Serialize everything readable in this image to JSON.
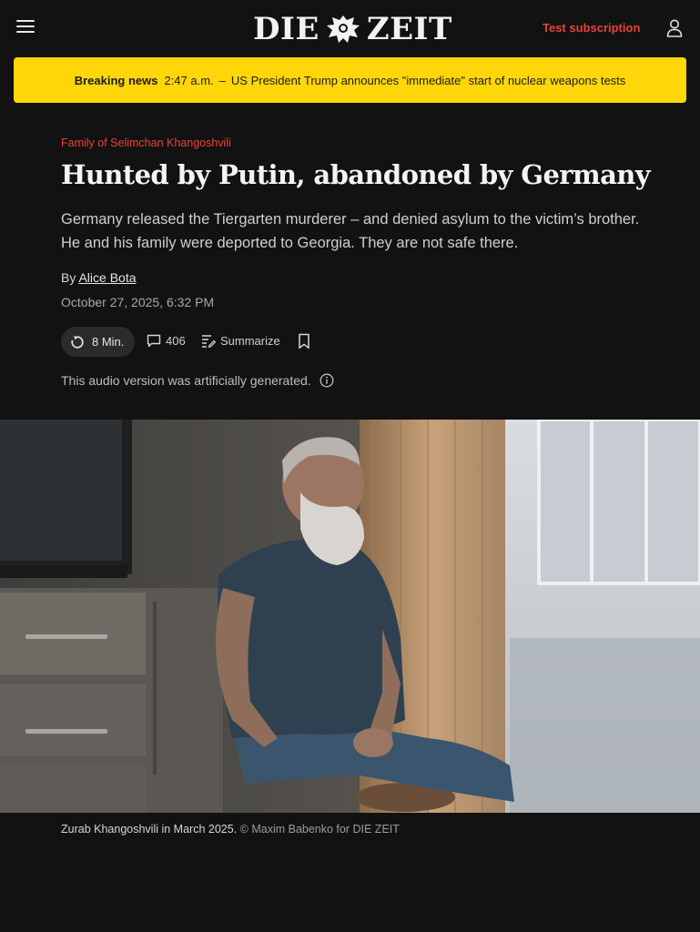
{
  "header": {
    "logo_left": "DIE",
    "logo_right": "ZEIT",
    "subscription_label": "Test subscription",
    "menu_icon": "hamburger-menu-icon",
    "account_icon": "user-icon",
    "accent_color": "#e8423a"
  },
  "breaking": {
    "label": "Breaking news",
    "time": "2:47 a.m.",
    "separator": "–",
    "text": "US President Trump announces \"immediate\" start of nuclear weapons tests",
    "background": "#ffd60a"
  },
  "article": {
    "kicker": "Family of Selimchan Khangoshvili",
    "title": "Hunted by Putin, abandoned by Germany",
    "dek": "Germany released the Tiergarten murderer – and denied asylum to the victim’s brother. He and his family were deported to Georgia. They are not safe there.",
    "byline_prefix": "By",
    "author": "Alice Bota",
    "date": "October 27, 2025, 6:32 PM",
    "actions": {
      "audio_label": "8 Min.",
      "comment_count": "406",
      "summarize_label": "Summarize"
    },
    "audio_note": "This audio version was artificially generated.",
    "image_caption": "Zurab Khangoshvili in March 2025.",
    "image_credit": "© Maxim Babenko for DIE ZEIT"
  }
}
